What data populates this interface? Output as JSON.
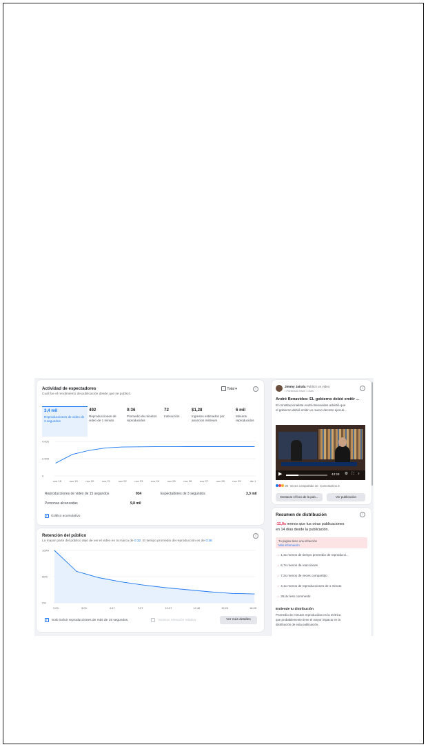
{
  "viewers": {
    "title": "Actividad de espectadores",
    "subtitle": "Cuál fue el rendimiento de publicación desde que se publicó.",
    "filter_label": "Total",
    "metrics": [
      {
        "value": "3,4 mil",
        "label": "Reproducciones de video de 3 segundos"
      },
      {
        "value": "492",
        "label": "Reproducciones de video de 1 minuto"
      },
      {
        "value": "0:36",
        "label": "Promedio de minutos reproducidos"
      },
      {
        "value": "72",
        "label": "Interacción"
      },
      {
        "value": "$1,28",
        "label": "Ingresos estimados por anuncios instream"
      },
      {
        "value": "6 mil",
        "label": "Minutos reproducidos"
      }
    ],
    "stats": {
      "row1_label": "Reproducciones de video de 15 segundos",
      "row1_value": "934",
      "row2_label": "Espectadores de 3 segundos",
      "row2_value": "3,3 mil",
      "row3_label": "Personas alcanzadas",
      "row3_value": "9,8 mil"
    },
    "cumulative_label": "Gráfico acumulativo"
  },
  "retention": {
    "title": "Retención del público",
    "subtitle_prefix": "La mayor parte del público dejó de ver el video en la marca de ",
    "subtitle_mark": "0:32",
    "subtitle_mid": ". El tiempo promedio de reproducción es de ",
    "subtitle_avg": "0:36",
    "include_label": "Solo incluir reproducciones de más de 15 segundos",
    "relative_label": "Mostrar retención relativa",
    "details_button": "Ver más detalles"
  },
  "post": {
    "author": "Jimmy Jairala",
    "action": "Publicó un video",
    "meta": "• Publicado hace 1 días",
    "headline": "André Benavides: EL gobierno debió emitir ...",
    "excerpt_1": "El constitucionalista André Benavides advirtió que",
    "excerpt_2": "el gobierno debió emitir un nuevo decreto ejecuti...",
    "video_time": "-12:18",
    "reactions_count": "39",
    "shares": "Veces compartido 10",
    "comments": "Comentarios 3",
    "boost_button": "Destacar el foco de la pub...",
    "view_button": "Ver publicación"
  },
  "distribution": {
    "title": "Resumen de distribución",
    "headline_value": "-11,0x",
    "headline_text_1": " menos que tus otras publicaciones",
    "headline_text_2": "en 14 días desde la publicación.",
    "alert_text": "Tu página tiene una infracción",
    "alert_link": "Más información",
    "items": [
      "1,3x menos de tiempo promedio de reproducci...",
      "6,7x menos de reacciones",
      "7,2x menos de veces compartido",
      "4,1x menos de reproducciones de 1 minuto",
      "39,4x less comments"
    ],
    "explain_title": "Entiende tu distribución",
    "explain_1": "Promedio de minutos reproducidos es la métrica",
    "explain_2": "que probablemente tiene el mayor impacto en la",
    "explain_3": "distribución de esta publicación."
  },
  "chart_data": [
    {
      "type": "line",
      "title": "",
      "x": [
        "nov 18",
        "nov 19",
        "nov 20",
        "nov 21",
        "nov 22",
        "nov 23",
        "nov 24",
        "nov 25",
        "nov 26",
        "nov 27",
        "nov 28",
        "nov 29",
        "dic 1"
      ],
      "series": [
        {
          "values": [
            1500,
            2500,
            2950,
            3250,
            3350,
            3380,
            3390,
            3395,
            3398,
            3400,
            3400,
            3400,
            3400
          ]
        }
      ],
      "yticks": [
        "0",
        "2.000",
        "4.000"
      ],
      "ylim": [
        0,
        4000
      ]
    },
    {
      "type": "area",
      "title": "",
      "x": [
        "0:00",
        "3:03",
        "4:47",
        "7:27",
        "10:07",
        "12:46",
        "15:26",
        "18:05"
      ],
      "series": [
        {
          "values": [
            100,
            60,
            48,
            40,
            34,
            29,
            25,
            21,
            18,
            17
          ]
        }
      ],
      "yticks": [
        "0%",
        "50%",
        "100%"
      ],
      "ylim": [
        0,
        100
      ]
    }
  ]
}
